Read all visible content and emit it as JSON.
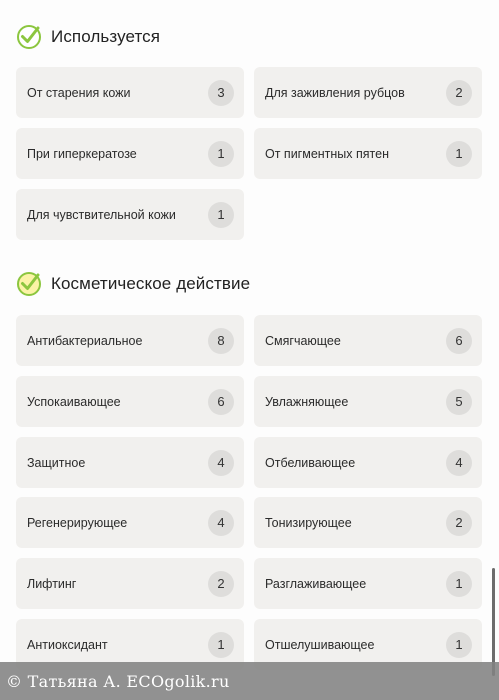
{
  "sections": [
    {
      "title": "Используется",
      "check_color": "#8cc63f",
      "check_fill": "#ffffff",
      "items": [
        {
          "label": "От старения кожи",
          "count": "3"
        },
        {
          "label": "Для заживления рубцов",
          "count": "2"
        },
        {
          "label": "При гиперкератозе",
          "count": "1"
        },
        {
          "label": "От пигментных пятен",
          "count": "1"
        },
        {
          "label": "Для чувствительной кожи",
          "count": "1"
        }
      ]
    },
    {
      "title": "Косметическое действие",
      "check_color": "#8cc63f",
      "check_fill": "#fbf3a6",
      "items": [
        {
          "label": "Антибактериальное",
          "count": "8"
        },
        {
          "label": "Смягчающее",
          "count": "6"
        },
        {
          "label": "Успокаивающее",
          "count": "6"
        },
        {
          "label": "Увлажняющее",
          "count": "5"
        },
        {
          "label": "Защитное",
          "count": "4"
        },
        {
          "label": "Отбеливающее",
          "count": "4"
        },
        {
          "label": "Регенерирующее",
          "count": "4"
        },
        {
          "label": "Тонизирующее",
          "count": "2"
        },
        {
          "label": "Лифтинг",
          "count": "2"
        },
        {
          "label": "Разглаживающее",
          "count": "1"
        },
        {
          "label": "Антиоксидант",
          "count": "1"
        },
        {
          "label": "Отшелушивающее",
          "count": "1"
        }
      ]
    }
  ],
  "watermark": {
    "text": "© Татьяна А. ECOgolik.ru"
  },
  "colors": {
    "tag_bg": "#f1f0ee",
    "count_bg": "#dedddb",
    "accent_green": "#8cc63f"
  }
}
